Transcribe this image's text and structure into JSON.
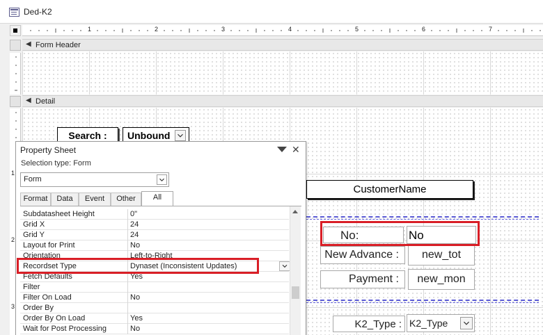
{
  "window": {
    "title": "Ded-K2"
  },
  "ruler": {
    "numbers": [
      "1",
      "2",
      "3",
      "4",
      "5",
      "6",
      "7"
    ],
    "vertical_numbers": [
      "1",
      "2",
      "3"
    ]
  },
  "sections": {
    "form_header": "Form Header",
    "detail": "Detail"
  },
  "form": {
    "search_label": "Search :",
    "unbound_value": "Unbound",
    "customer_name": "CustomerName",
    "no_label": "No:",
    "no_value": "No",
    "new_advance_label": "New Advance :",
    "new_advance_value": "new_tot",
    "payment_label": "Payment :",
    "payment_value": "new_mon",
    "k2_type_label": "K2_Type :",
    "k2_type_value": "K2_Type"
  },
  "property_sheet": {
    "title": "Property Sheet",
    "selection_type": "Selection type:  Form",
    "object": "Form",
    "tabs": [
      "Format",
      "Data",
      "Event",
      "Other",
      "All"
    ],
    "active_tab": "All",
    "rows": [
      {
        "name": "Subdatasheet Height",
        "value": "0\""
      },
      {
        "name": "Grid X",
        "value": "24"
      },
      {
        "name": "Grid Y",
        "value": "24"
      },
      {
        "name": "Layout for Print",
        "value": "No"
      },
      {
        "name": "Orientation",
        "value": "Left-to-Right"
      },
      {
        "name": "Recordset Type",
        "value": "Dynaset (Inconsistent Updates)"
      },
      {
        "name": "Fetch Defaults",
        "value": "Yes"
      },
      {
        "name": "Filter",
        "value": ""
      },
      {
        "name": "Filter On Load",
        "value": "No"
      },
      {
        "name": "Order By",
        "value": ""
      },
      {
        "name": "Order By On Load",
        "value": "Yes"
      },
      {
        "name": "Wait for Post Processing",
        "value": "No"
      }
    ]
  },
  "highlight_color": "#d91e26"
}
